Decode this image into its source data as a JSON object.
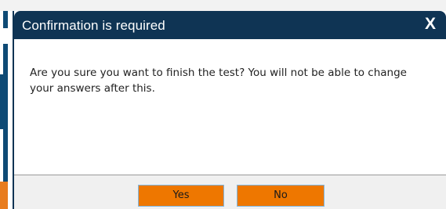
{
  "dialog": {
    "title": "Confirmation is required",
    "close_label": "X",
    "message": "Are you sure you want to finish the test? You will not be able to change your answers after this.",
    "buttons": {
      "yes_label": "Yes",
      "no_label": "No"
    }
  },
  "colors": {
    "titlebar": "#0f3454",
    "button": "#ee7700",
    "footer": "#f0f0f0"
  }
}
